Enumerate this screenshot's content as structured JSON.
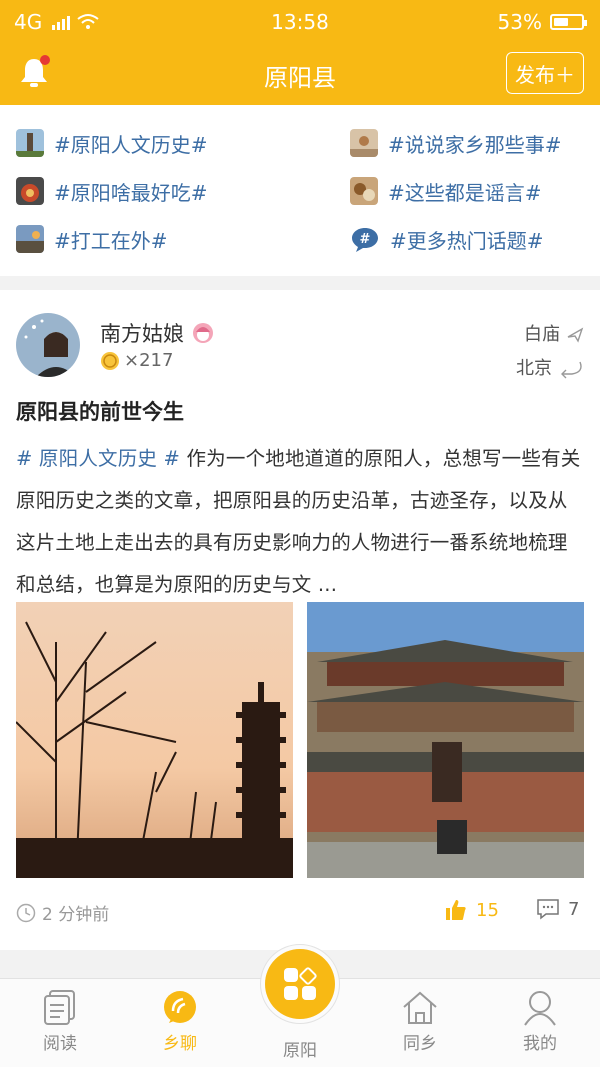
{
  "status_bar": {
    "network": "4G",
    "time": "13:58",
    "battery": "53%",
    "battery_level": 0.53
  },
  "header": {
    "title": "原阳县",
    "publish_label": "发布＋"
  },
  "topics": [
    {
      "label": "#原阳人文历史#",
      "icon": "pagoda-thumb"
    },
    {
      "label": "#说说家乡那些事#",
      "icon": "village-thumb"
    },
    {
      "label": "#原阳啥最好吃#",
      "icon": "food-thumb"
    },
    {
      "label": "#这些都是谣言#",
      "icon": "dishes-thumb"
    },
    {
      "label": "#打工在外#",
      "icon": "road-thumb"
    },
    {
      "label": "#更多热门话题#",
      "icon": "hash-bubble-icon"
    }
  ],
  "post": {
    "author": "南方姑娘",
    "coins": "×217",
    "route_from": "白庙",
    "route_to": "北京",
    "title": "原阳县的前世今生",
    "tag": "# 原阳人文历史 #",
    "body": " 作为一个地地道道的原阳人，总想写一些有关原阳历史之类的文章，把原阳县的历史沿革，古迹圣存，以及从这片土地上走出去的具有历史影响力的人物进行一番系统地梳理和总结，也算是为原阳的历史与文 ...",
    "time": "2 分钟前",
    "likes": "15",
    "comments": "7"
  },
  "tabs": [
    {
      "label": "阅读",
      "icon": "document-icon"
    },
    {
      "label": "乡聊",
      "icon": "chat-icon"
    },
    {
      "label": "原阳",
      "icon": "grid-icon"
    },
    {
      "label": "同乡",
      "icon": "home-icon"
    },
    {
      "label": "我的",
      "icon": "user-icon"
    }
  ],
  "colors": {
    "accent": "#f8b914",
    "link": "#3d6ea5"
  }
}
